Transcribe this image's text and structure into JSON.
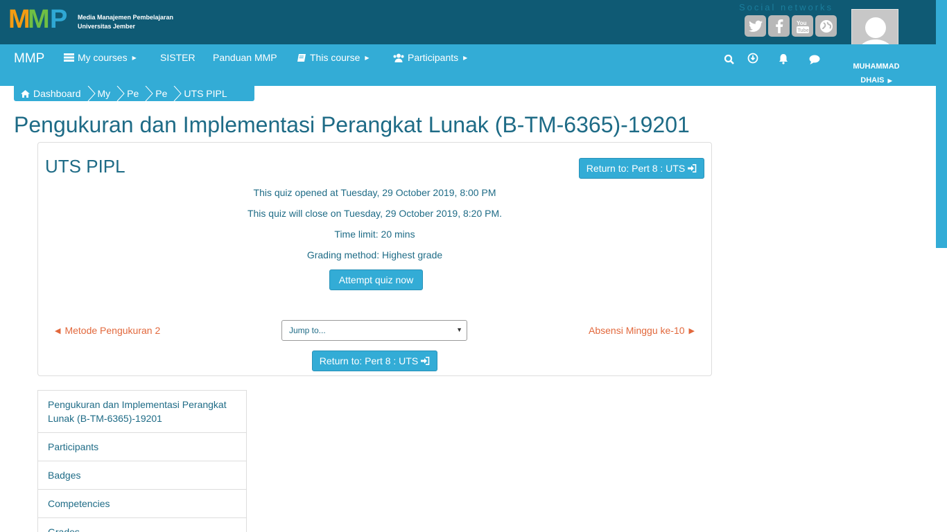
{
  "brand": {
    "logo_text": "MMP",
    "line1": "Media Manajemen Pembelajaran",
    "line2": "Universitas Jember"
  },
  "social": {
    "title": "Social networks",
    "icons": [
      "twitter-icon",
      "facebook-icon",
      "youtube-icon",
      "globe-icon"
    ]
  },
  "nav": {
    "home": "MMP",
    "my_courses": "My courses",
    "sister": "SISTER",
    "panduan": "Panduan MMP",
    "this_course": "This course",
    "participants": "Participants"
  },
  "user": {
    "first": "MUHAMMAD",
    "last": "DHAIS"
  },
  "breadcrumb": {
    "dashboard": "Dashboard",
    "my": "My",
    "pe1": "Pe",
    "pe2": "Pe",
    "current": "UTS PIPL"
  },
  "page_title": "Pengukuran dan Implementasi Perangkat Lunak (B-TM-6365)-19201",
  "quiz": {
    "title": "UTS PIPL",
    "return_label": "Return to: Pert 8 : UTS",
    "opened": "This quiz opened at Tuesday, 29 October 2019, 8:00 PM",
    "close": "This quiz will close on Tuesday, 29 October 2019, 8:20 PM.",
    "time_limit": "Time limit: 20 mins",
    "grading": "Grading method: Highest grade",
    "attempt_label": "Attempt quiz now"
  },
  "activity_nav": {
    "prev": "Metode Pengukuran 2",
    "next": "Absensi Minggu ke-10",
    "jump_placeholder": "Jump to..."
  },
  "sidenav": {
    "items": [
      "Pengukuran dan Implementasi Perangkat Lunak (B-TM-6365)-19201",
      "Participants",
      "Badges",
      "Competencies",
      "Grades"
    ]
  },
  "colors": {
    "header_dark": "#0f5a74",
    "nav_blue": "#33acd6",
    "text_teal": "#1e6b86",
    "link_orange": "#e2683c"
  }
}
